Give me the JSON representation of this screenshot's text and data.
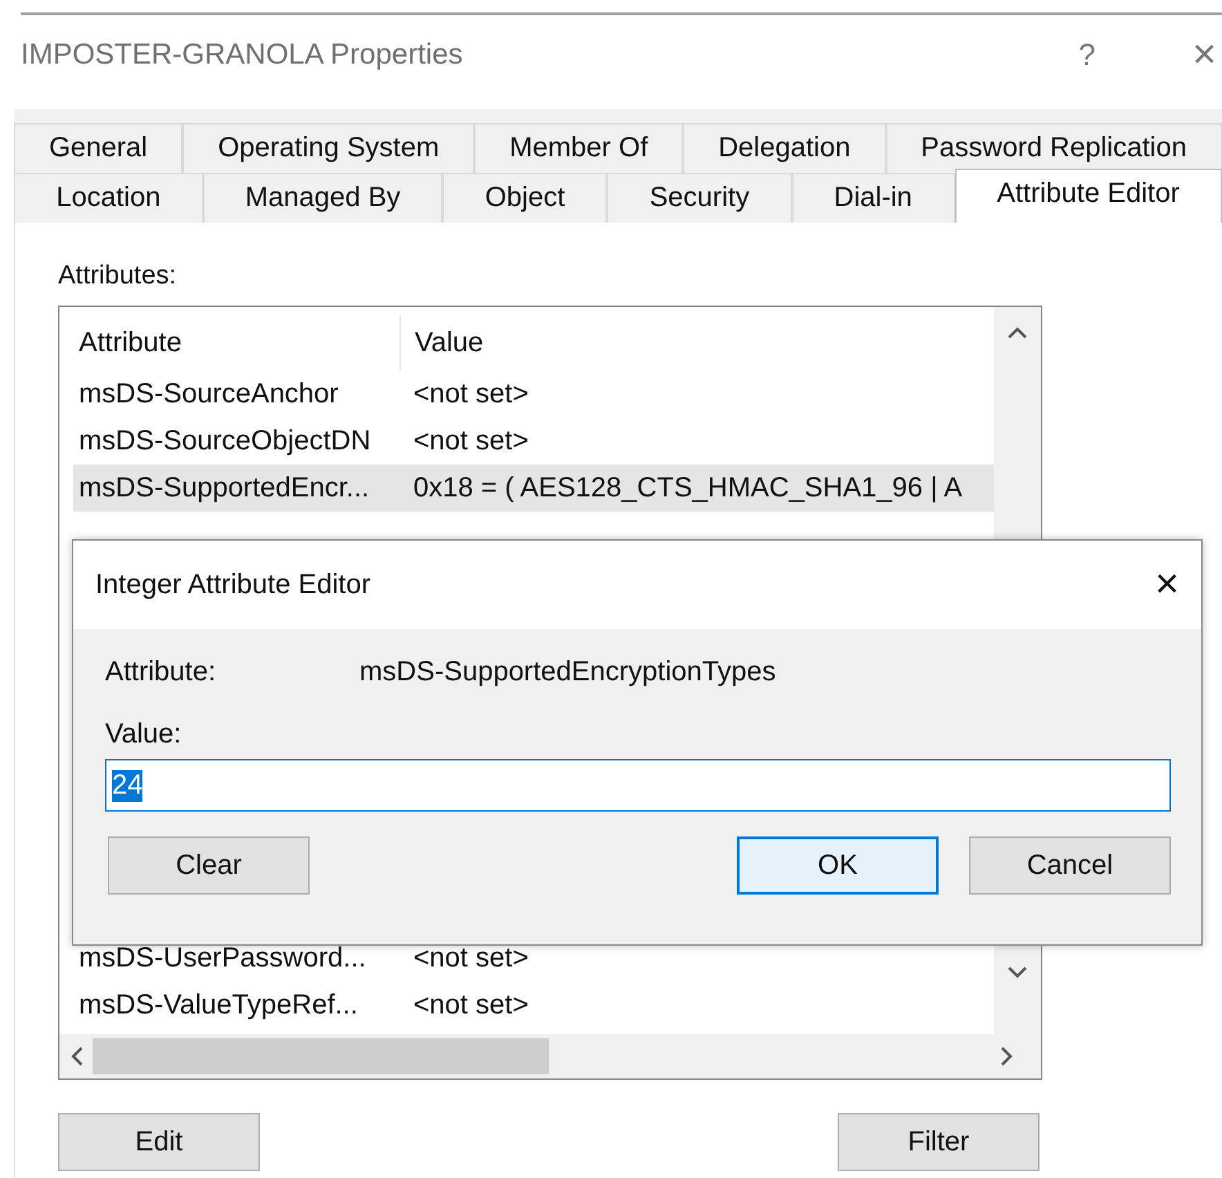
{
  "window": {
    "title": "IMPOSTER-GRANOLA Properties",
    "help": "?",
    "close": "×"
  },
  "tab_rows": [
    [
      {
        "label": "General",
        "selected": false
      },
      {
        "label": "Operating System",
        "selected": false
      },
      {
        "label": "Member Of",
        "selected": false
      },
      {
        "label": "Delegation",
        "selected": false
      },
      {
        "label": "Password Replication",
        "selected": false
      }
    ],
    [
      {
        "label": "Location",
        "selected": false
      },
      {
        "label": "Managed By",
        "selected": false
      },
      {
        "label": "Object",
        "selected": false
      },
      {
        "label": "Security",
        "selected": false
      },
      {
        "label": "Dial-in",
        "selected": false
      },
      {
        "label": "Attribute Editor",
        "selected": true
      }
    ]
  ],
  "attributes_label": "Attributes:",
  "table": {
    "columns": [
      "Attribute",
      "Value"
    ],
    "rows": [
      {
        "attribute": "msDS-SourceAnchor",
        "value": "<not set>",
        "selected": false
      },
      {
        "attribute": "msDS-SourceObjectDN",
        "value": "<not set>",
        "selected": false
      },
      {
        "attribute": "msDS-SupportedEncr...",
        "value": "0x18 = ( AES128_CTS_HMAC_SHA1_96 | A",
        "selected": true
      },
      {
        "attribute": "msDS-UserPassword...",
        "value": "<not set>",
        "selected": false
      },
      {
        "attribute": "msDS-ValueTypeRef...",
        "value": "<not set>",
        "selected": false
      }
    ]
  },
  "buttons": [
    "Edit",
    "Filter"
  ],
  "dialog": {
    "title": "Integer Attribute Editor",
    "close": "×",
    "attribute_label": "Attribute:",
    "attribute_value": "msDS-SupportedEncryptionTypes",
    "value_label": "Value:",
    "value": "24",
    "buttons": [
      {
        "label": "Clear",
        "default": false
      },
      {
        "label": "OK",
        "default": true
      },
      {
        "label": "Cancel",
        "default": false
      }
    ]
  }
}
